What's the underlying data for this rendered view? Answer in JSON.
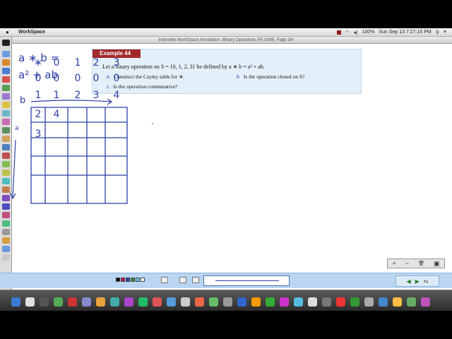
{
  "menubar": {
    "app_name": "WorkSpace",
    "battery": "100%",
    "clock": "Sun Sep 13  7:27:15 PM"
  },
  "window": {
    "title": "Interwrite WorkSpace Annotation -Binary Operations P5.GWB, Page 3/4"
  },
  "example": {
    "header": "Example 44",
    "stem": "Let a binary operation on   S = {0, 1, 2, 3}  be defined by  a ∗ b = a² + ab.",
    "items": [
      {
        "label": "a",
        "text": "Construct the Cayley table for ∗."
      },
      {
        "label": "b",
        "text": "Is the operation closed on S?"
      },
      {
        "label": "c",
        "text": "Is the operation commutative?"
      }
    ]
  },
  "handwriting": {
    "def_line1": "a ∗ b =",
    "def_line2": "a² + ab",
    "col_var": "b",
    "row_var": "a",
    "table": {
      "corner": "∗",
      "headers": [
        "0",
        "1",
        "2",
        "3"
      ],
      "rows": [
        {
          "label": "0",
          "cells": [
            "0",
            "0",
            "0",
            "0"
          ]
        },
        {
          "label": "1",
          "cells": [
            "1",
            "2",
            "3",
            "4"
          ]
        },
        {
          "label": "2",
          "cells": [
            "4",
            "",
            "",
            ""
          ]
        },
        {
          "label": "3",
          "cells": [
            "",
            "",
            "",
            ""
          ]
        }
      ]
    }
  },
  "page_controls": {
    "add": "+",
    "remove": "−",
    "delete": "🗑"
  },
  "pager": {
    "prev": "◀",
    "next": "▶"
  },
  "colors": {
    "ink": "#2b3fa6",
    "example_header": "#a3282a",
    "example_bg": "#e3eff9",
    "toolbar": "#b9d5f1"
  }
}
